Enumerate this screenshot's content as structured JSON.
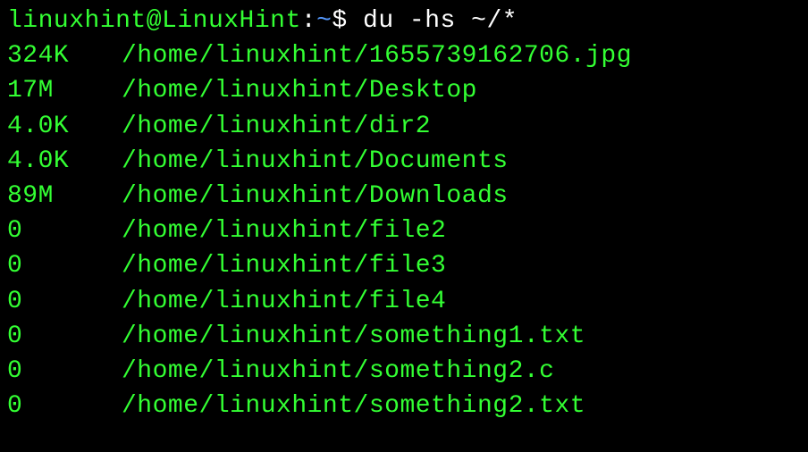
{
  "prompt": {
    "user": "linuxhint",
    "at": "@",
    "host": "LinuxHint",
    "colon": ":",
    "path": "~",
    "dollar": "$ ",
    "command": "du -hs ~/*"
  },
  "output": [
    {
      "size": "324K",
      "path": "/home/linuxhint/1655739162706.jpg"
    },
    {
      "size": "17M",
      "path": "/home/linuxhint/Desktop"
    },
    {
      "size": "4.0K",
      "path": "/home/linuxhint/dir2"
    },
    {
      "size": "4.0K",
      "path": "/home/linuxhint/Documents"
    },
    {
      "size": "89M",
      "path": "/home/linuxhint/Downloads"
    },
    {
      "size": "0",
      "path": "/home/linuxhint/file2"
    },
    {
      "size": "0",
      "path": "/home/linuxhint/file3"
    },
    {
      "size": "0",
      "path": "/home/linuxhint/file4"
    },
    {
      "size": "0",
      "path": "/home/linuxhint/something1.txt"
    },
    {
      "size": "0",
      "path": "/home/linuxhint/something2.c"
    },
    {
      "size": "0",
      "path": "/home/linuxhint/something2.txt"
    }
  ]
}
